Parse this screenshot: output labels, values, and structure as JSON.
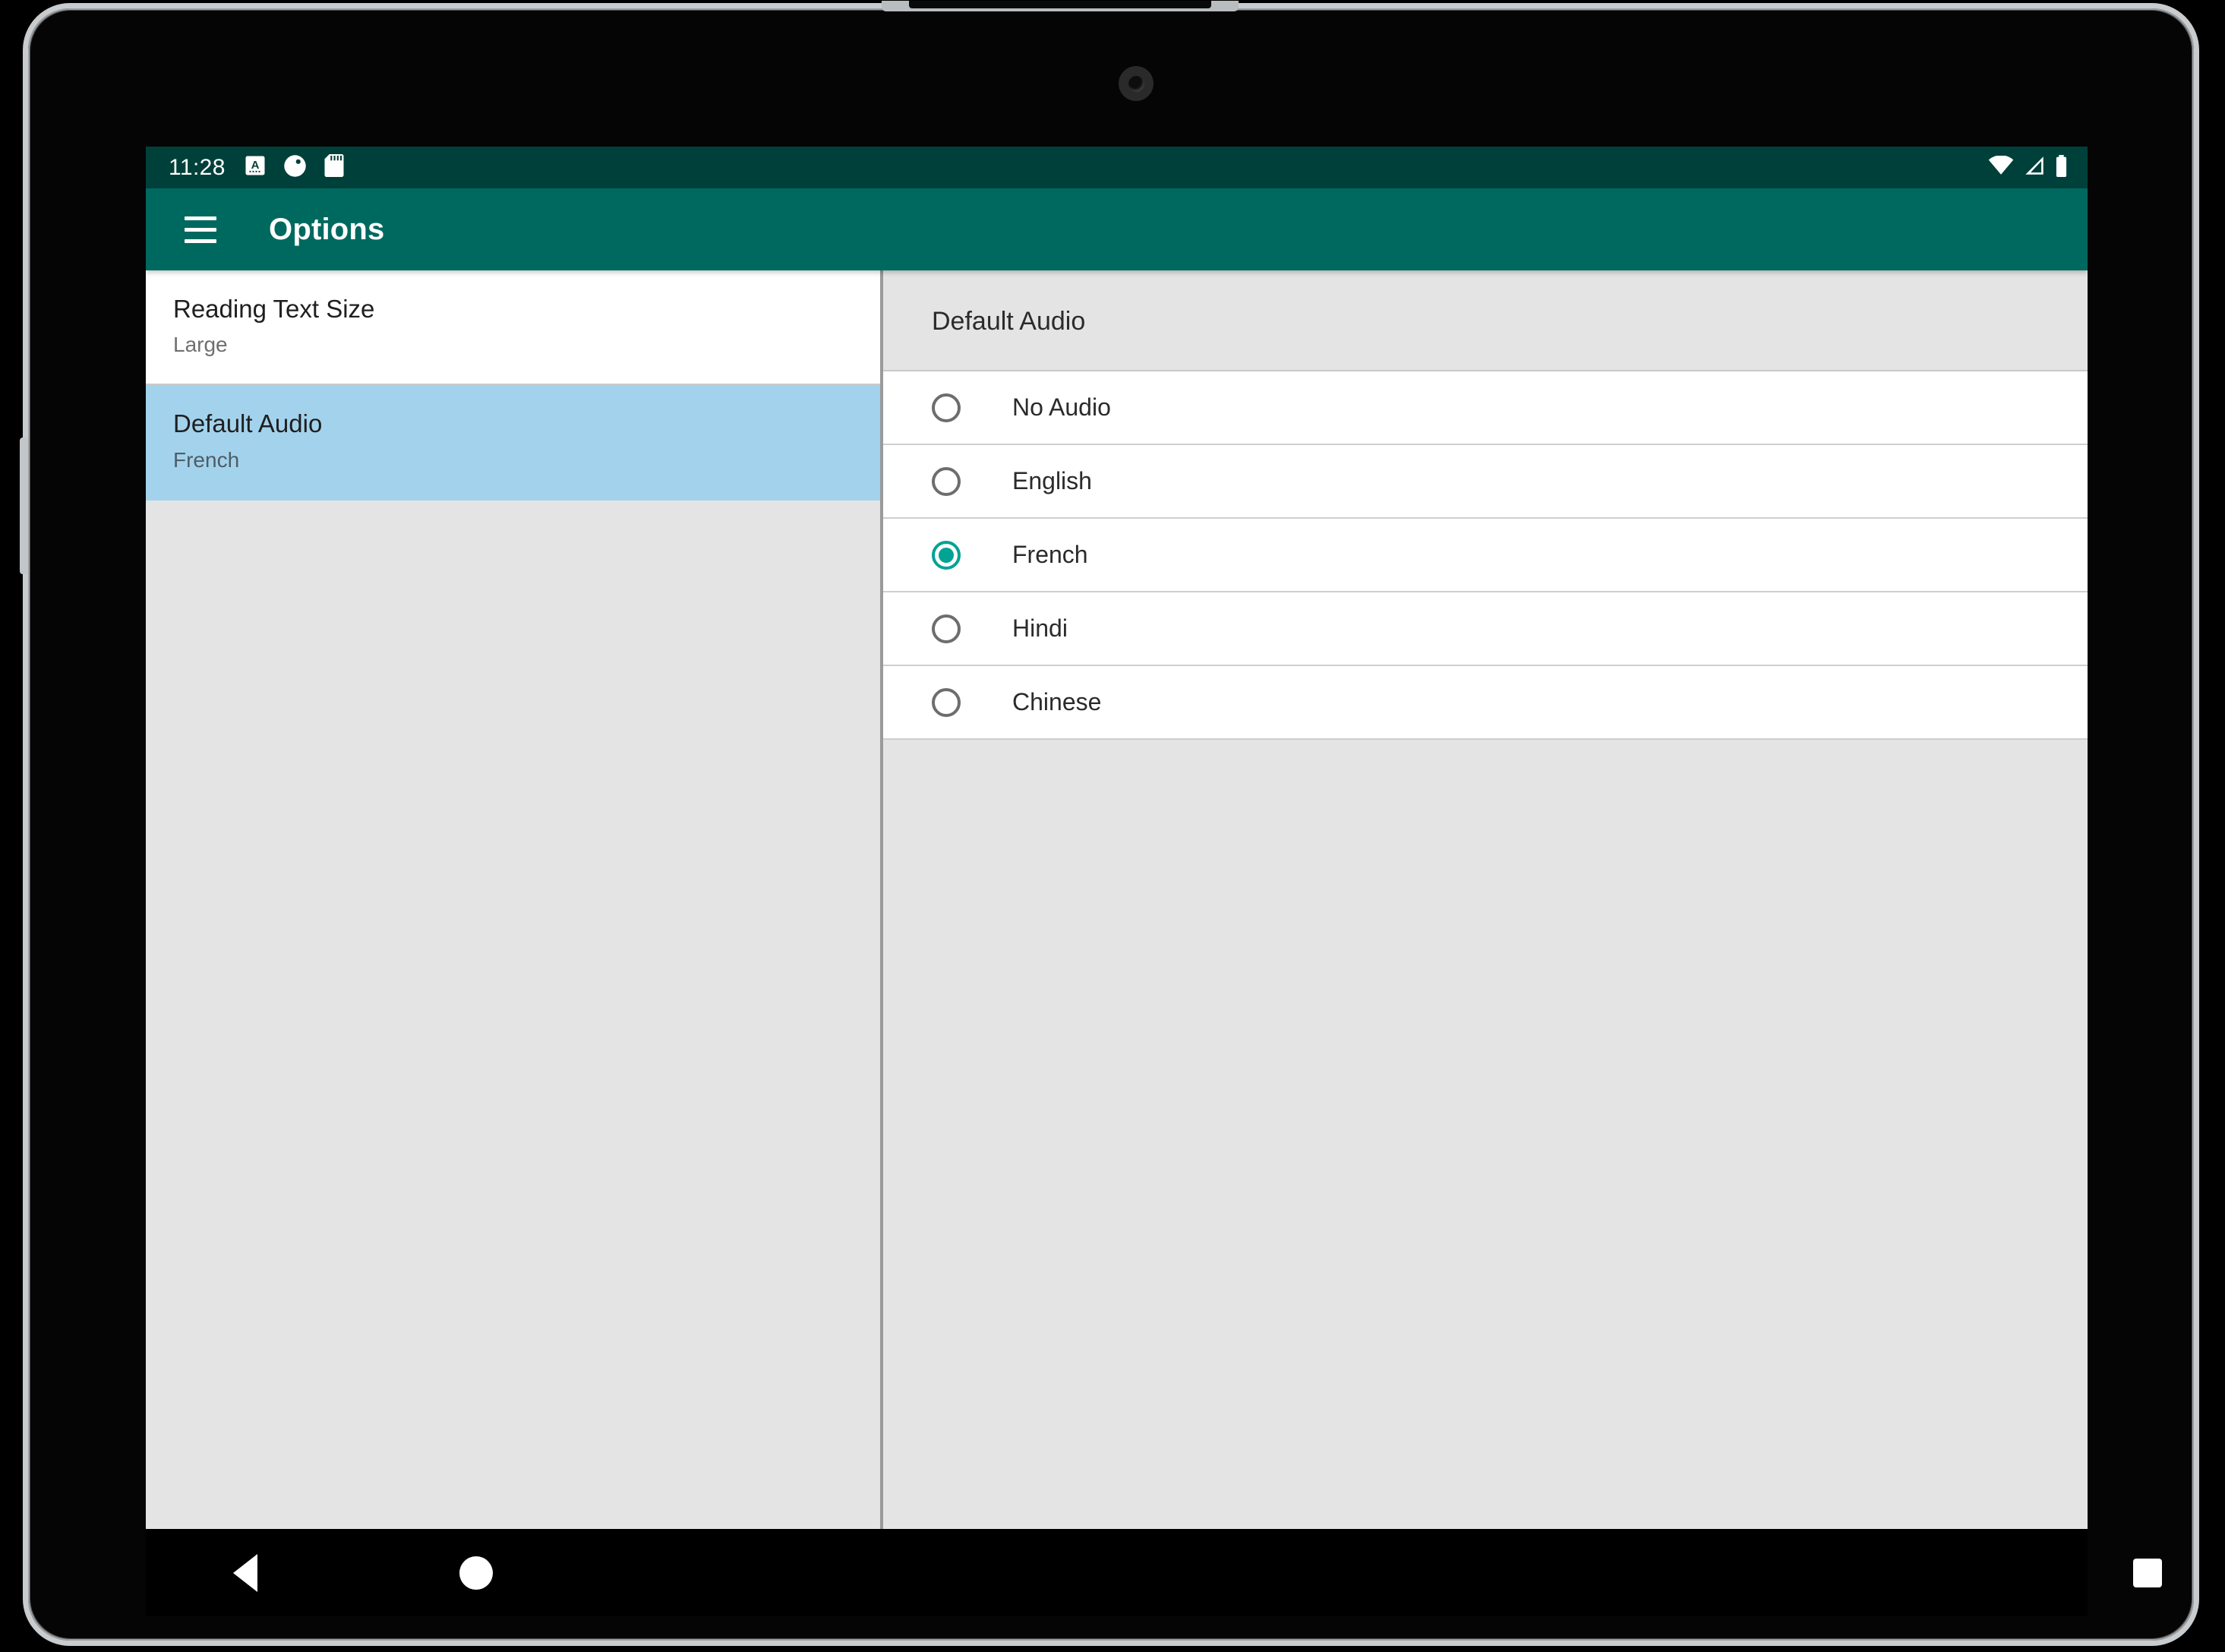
{
  "status_bar": {
    "clock": "11:28",
    "left_icons": [
      "captions-icon",
      "contrast-icon",
      "sd-card-icon"
    ],
    "right_icons": [
      "wifi-icon",
      "cellular-signal-icon",
      "battery-icon"
    ]
  },
  "app_bar": {
    "menu_icon": "hamburger-menu-icon",
    "title": "Options"
  },
  "left_pane": {
    "items": [
      {
        "title": "Reading Text Size",
        "summary": "Large",
        "selected": false
      },
      {
        "title": "Default Audio",
        "summary": "French",
        "selected": true
      }
    ]
  },
  "right_pane": {
    "header": "Default Audio",
    "options": [
      {
        "label": "No Audio",
        "checked": false
      },
      {
        "label": "English",
        "checked": false
      },
      {
        "label": "French",
        "checked": true
      },
      {
        "label": "Hindi",
        "checked": false
      },
      {
        "label": "Chinese",
        "checked": false
      }
    ]
  },
  "nav_bar": {
    "back": "back-triangle-icon",
    "home": "home-circle-icon",
    "recents": "recents-square-icon"
  },
  "colors": {
    "status_bar": "#00403a",
    "app_bar": "#00695f",
    "accent": "#00a394",
    "selection": "#a3d3ec",
    "background": "#e4e4e4"
  }
}
